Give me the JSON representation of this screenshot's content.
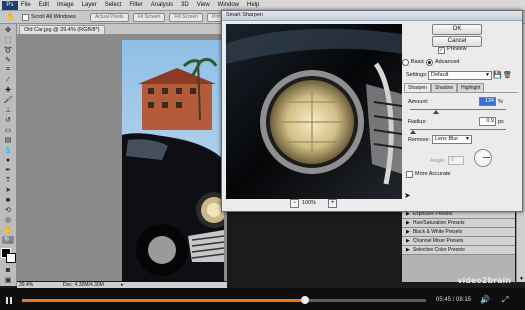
{
  "menubar": {
    "app_logo": "Ps",
    "items": [
      "File",
      "Edit",
      "Image",
      "Layer",
      "Select",
      "Filter",
      "Analysis",
      "3D",
      "View",
      "Window",
      "Help"
    ]
  },
  "options_bar": {
    "scroll_all_windows": "Scroll All Windows",
    "buttons": [
      "Actual Pixels",
      "Fit Screen",
      "Fill Screen",
      "Print Size"
    ]
  },
  "document": {
    "tab_title": "Old Car.jpg @ 39.4% (RGB/8*)",
    "zoom": "39.4%",
    "doc_info": "Doc: 4.30M/4.30M"
  },
  "dialog": {
    "title": "Smart Sharpen",
    "ok_label": "OK",
    "cancel_label": "Cancel",
    "preview_label": "Preview",
    "preview_checked": true,
    "basic_label": "Basic",
    "advanced_label": "Advanced",
    "mode_selected": "Advanced",
    "settings_label": "Settings:",
    "settings_value": "Default",
    "tabs": [
      "Sharpen",
      "Shadow",
      "Highlight"
    ],
    "active_tab": "Sharpen",
    "amount_label": "Amount:",
    "amount_value": "134",
    "amount_unit": "%",
    "amount_level": 0.27,
    "radius_label": "Radius:",
    "radius_value": "0.9",
    "radius_unit": "px",
    "radius_level": 0.03,
    "remove_label": "Remove:",
    "remove_value": "Lens Blur",
    "angle_label": "Angle:",
    "angle_value": "0",
    "more_accurate_label": "More Accurate",
    "more_accurate_checked": false,
    "zoom_level": "100%",
    "zoom_out": "−",
    "zoom_in": "+"
  },
  "right_panel": {
    "presets": [
      "Exposure Presets",
      "Hue/Saturation Presets",
      "Black & White Presets",
      "Channel Mixer Presets",
      "Selective Color Presets"
    ]
  },
  "video_player": {
    "current_time": "05:45",
    "total_time": "08:15",
    "time_separator": "/",
    "progress": 0.7,
    "watermark": "video2brain",
    "accent_color": "#e87a1a"
  }
}
